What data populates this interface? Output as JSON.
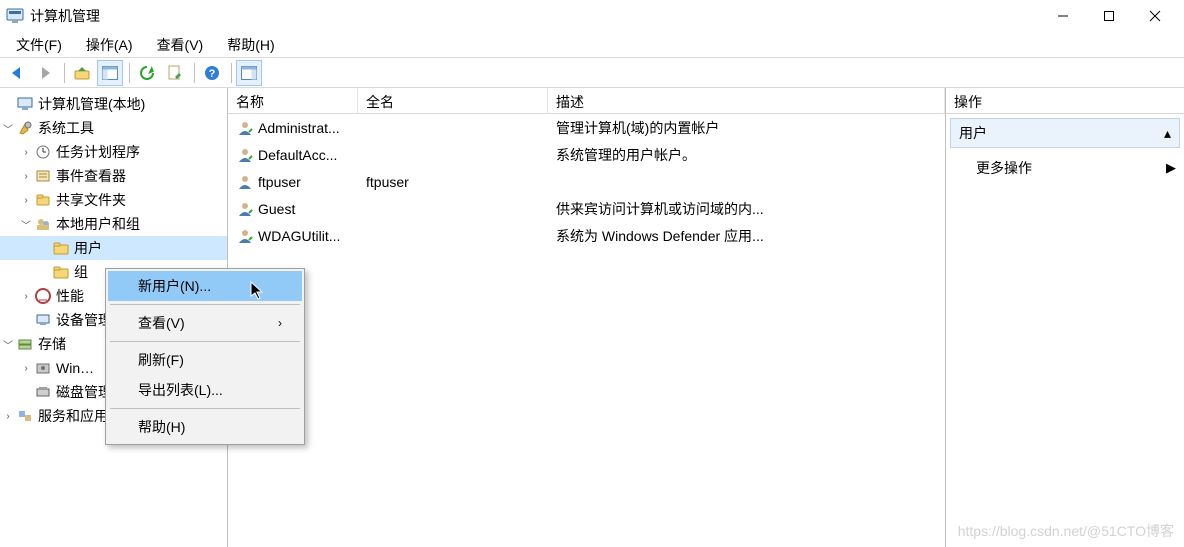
{
  "window": {
    "title": "计算机管理"
  },
  "menubar": {
    "file": "文件(F)",
    "action": "操作(A)",
    "view": "查看(V)",
    "help": "帮助(H)"
  },
  "tree": {
    "root": "计算机管理(本地)",
    "system_tools": "系统工具",
    "task_scheduler": "任务计划程序",
    "event_viewer": "事件查看器",
    "shared_folders": "共享文件夹",
    "local_users_groups": "本地用户和组",
    "users": "用户",
    "groups_trunc": "组",
    "performance": "性能",
    "device_manager": "设备管理器",
    "storage": "存储",
    "windows_trunc": "Win…",
    "disk": "磁盘管理",
    "services_apps": "服务和应用程序"
  },
  "list": {
    "columns": {
      "name": "名称",
      "full": "全名",
      "desc": "描述"
    },
    "rows": [
      {
        "name": "Administrat...",
        "full": "",
        "desc": "管理计算机(域)的内置帐户"
      },
      {
        "name": "DefaultAcc...",
        "full": "",
        "desc": "系统管理的用户帐户。"
      },
      {
        "name": "ftpuser",
        "full": "ftpuser",
        "desc": ""
      },
      {
        "name": "Guest",
        "full": "",
        "desc": "供来宾访问计算机或访问域的内..."
      },
      {
        "name": "WDAGUtilit...",
        "full": "",
        "desc": "系统为 Windows Defender 应用..."
      }
    ]
  },
  "actions_pane": {
    "header": "操作",
    "section": "用户",
    "more": "更多操作"
  },
  "context_menu": {
    "new_user": "新用户(N)...",
    "view": "查看(V)",
    "refresh": "刷新(F)",
    "export_list": "导出列表(L)...",
    "help": "帮助(H)"
  },
  "watermark": "https://blog.csdn.net/@51CTO博客"
}
